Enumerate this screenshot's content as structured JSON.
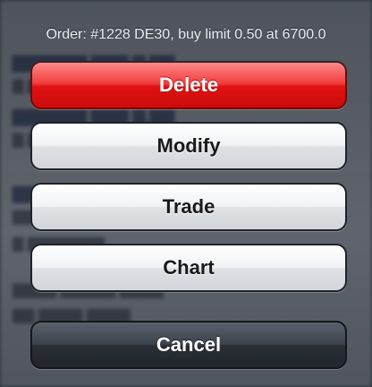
{
  "action_sheet": {
    "title": "Order: #1228 DE30, buy limit 0.50 at 6700.0",
    "buttons": {
      "delete": "Delete",
      "modify": "Modify",
      "trade": "Trade",
      "chart": "Chart",
      "cancel": "Cancel"
    }
  },
  "colors": {
    "delete_button": "#e01010",
    "overlay": "#2e343e"
  }
}
